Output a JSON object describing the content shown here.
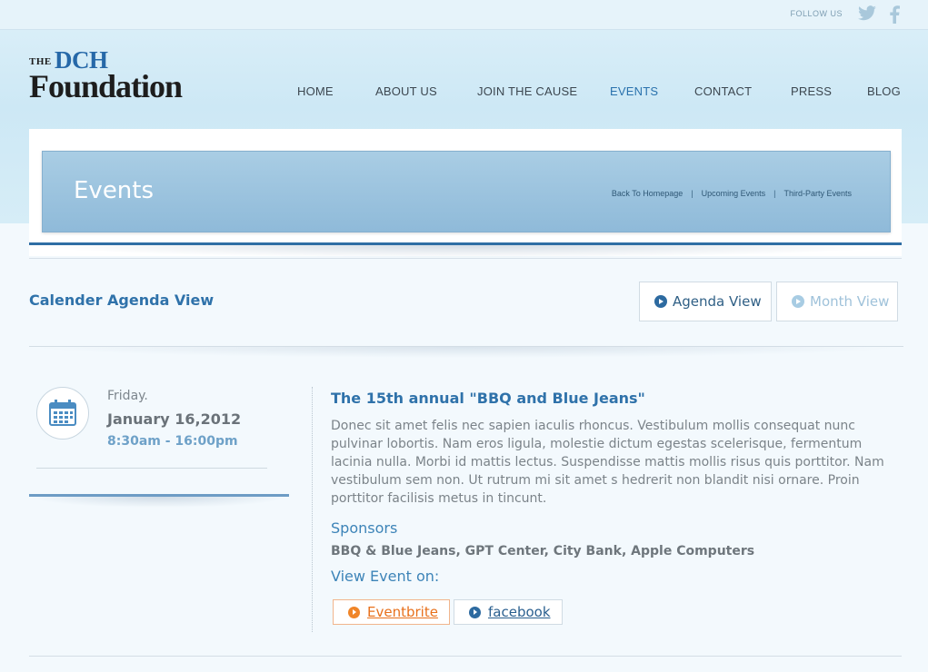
{
  "topbar": {
    "follow_label": "FOLLOW US"
  },
  "logo": {
    "the": "THE",
    "dch": "DCH",
    "foundation": "Foundation"
  },
  "nav": [
    {
      "label": "HOME"
    },
    {
      "label": "ABOUT US"
    },
    {
      "label": "JOIN THE CAUSE"
    },
    {
      "label": "EVENTS",
      "active": true
    },
    {
      "label": "CONTACT"
    },
    {
      "label": "PRESS"
    },
    {
      "label": "BLOG"
    }
  ],
  "banner": {
    "title": "Events",
    "crumbs": [
      "Back To Homepage",
      "Upcoming Events",
      "Third-Party Events"
    ]
  },
  "section": {
    "title": "Calender Agenda View",
    "agenda_button": "Agenda View",
    "month_button": "Month View"
  },
  "event": {
    "day": "Friday.",
    "date": "January 16,2012",
    "time": "8:30am - 16:00pm",
    "title": "The 15th annual \"BBQ and Blue Jeans\"",
    "description": "Donec sit amet felis nec sapien iaculis rhoncus. Vestibulum mollis consequat nunc pulvinar lobortis. Nam eros ligula, molestie dictum egestas scelerisque, fermentum lacinia nulla. Morbi id mattis lectus. Suspendisse mattis mollis risus quis porttitor. Nam vestibulum sem non. Ut rutrum mi sit amet s hedrerit non blandit nisi ornare. Proin porttitor facilisis metus in tincunt.",
    "sponsors_heading": "Sponsors",
    "sponsors": "BBQ & Blue Jeans, GPT Center, City Bank, Apple Computers",
    "view_on": "View Event on:",
    "links": [
      "Eventbrite",
      "facebook"
    ]
  },
  "colors": {
    "accent": "#2f72aa",
    "orange": "#e8701b",
    "banner": "#9cc4df"
  }
}
